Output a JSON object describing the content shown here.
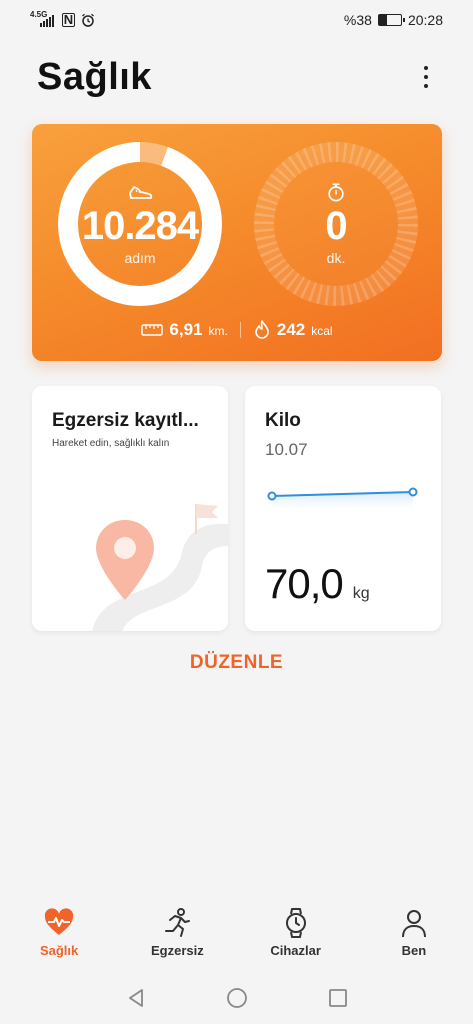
{
  "status_bar": {
    "network": "4.5G",
    "battery": "%38",
    "battery_level": 0.38,
    "time": "20:28",
    "icons": [
      "signal-icon",
      "nfc-icon",
      "alarm-icon",
      "battery-icon"
    ]
  },
  "header": {
    "title": "Sağlık",
    "menu_icon": "more-vertical-icon"
  },
  "activity": {
    "steps": "10.284",
    "steps_unit": "adım",
    "steps_icon": "shoe-icon",
    "minutes": "0",
    "minutes_unit": "dk.",
    "minutes_icon": "stopwatch-icon",
    "distance": "6,91",
    "distance_unit": "km.",
    "distance_icon": "ruler-icon",
    "calories": "242",
    "calories_unit": "kcal",
    "calories_icon": "flame-icon",
    "colors": {
      "card_start": "#f8a03c",
      "card_end": "#f26f22"
    }
  },
  "tiles": {
    "exercise": {
      "title": "Egzersiz kayıtl...",
      "subtitle": "Hareket edin, sağlıklı kalın",
      "illustration": "location-pin-icon"
    },
    "weight": {
      "title": "Kilo",
      "date": "10.07",
      "value": "70,0",
      "unit": "kg",
      "line_color": "#2d8fe0"
    }
  },
  "edit_label": "DÜZENLE",
  "bottom_nav": [
    {
      "label": "Sağlık",
      "icon": "heart-pulse-icon",
      "active": true
    },
    {
      "label": "Egzersiz",
      "icon": "running-icon",
      "active": false
    },
    {
      "label": "Cihazlar",
      "icon": "watch-icon",
      "active": false
    },
    {
      "label": "Ben",
      "icon": "person-icon",
      "active": false
    }
  ],
  "accent_color": "#f0632a"
}
